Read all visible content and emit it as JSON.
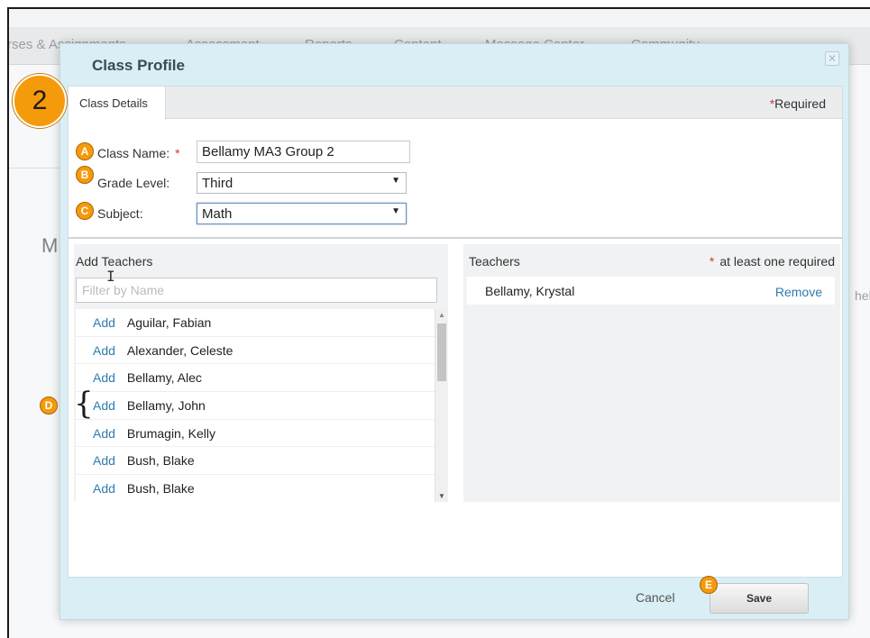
{
  "background": {
    "nav_items": [
      "rses & Assignments",
      "Assessment",
      "Reports",
      "Content",
      "Message Center",
      "Community"
    ],
    "page_letter": "M",
    "edge_text": "hel"
  },
  "dialog": {
    "title": "Class Profile",
    "close_icon": "close-icon",
    "tab_label": "Class Details",
    "required_star": "*",
    "required_label": "Required",
    "class_name_label": "Class Name:",
    "class_name_star": "*",
    "class_name_value": "Bellamy MA3 Group 2",
    "grade_level_label": "Grade Level:",
    "grade_level_value": "Third",
    "subject_label": "Subject:",
    "subject_value": "Math",
    "add_teachers_header": "Add Teachers",
    "filter_placeholder": "Filter by Name",
    "add_label": "Add",
    "available_teachers": [
      "Aguilar, Fabian",
      "Alexander, Celeste",
      "Bellamy, Alec",
      "Bellamy, John",
      "Brumagin, Kelly",
      "Bush, Blake",
      "Bush, Blake"
    ],
    "teachers_header": "Teachers",
    "teachers_req_star": "*",
    "teachers_req_label": "at least one required",
    "selected_teacher": "Bellamy, Krystal",
    "remove_label": "Remove",
    "cancel_label": "Cancel",
    "save_label": "Save"
  },
  "annotations": {
    "step": "2",
    "a": "A",
    "b": "B",
    "c": "C",
    "d": "D",
    "e": "E"
  },
  "colors": {
    "accent_orange": "#f59a0b",
    "link_blue": "#2f7bb0",
    "required_red": "#d03a3a",
    "modal_bg": "#daeef5"
  }
}
